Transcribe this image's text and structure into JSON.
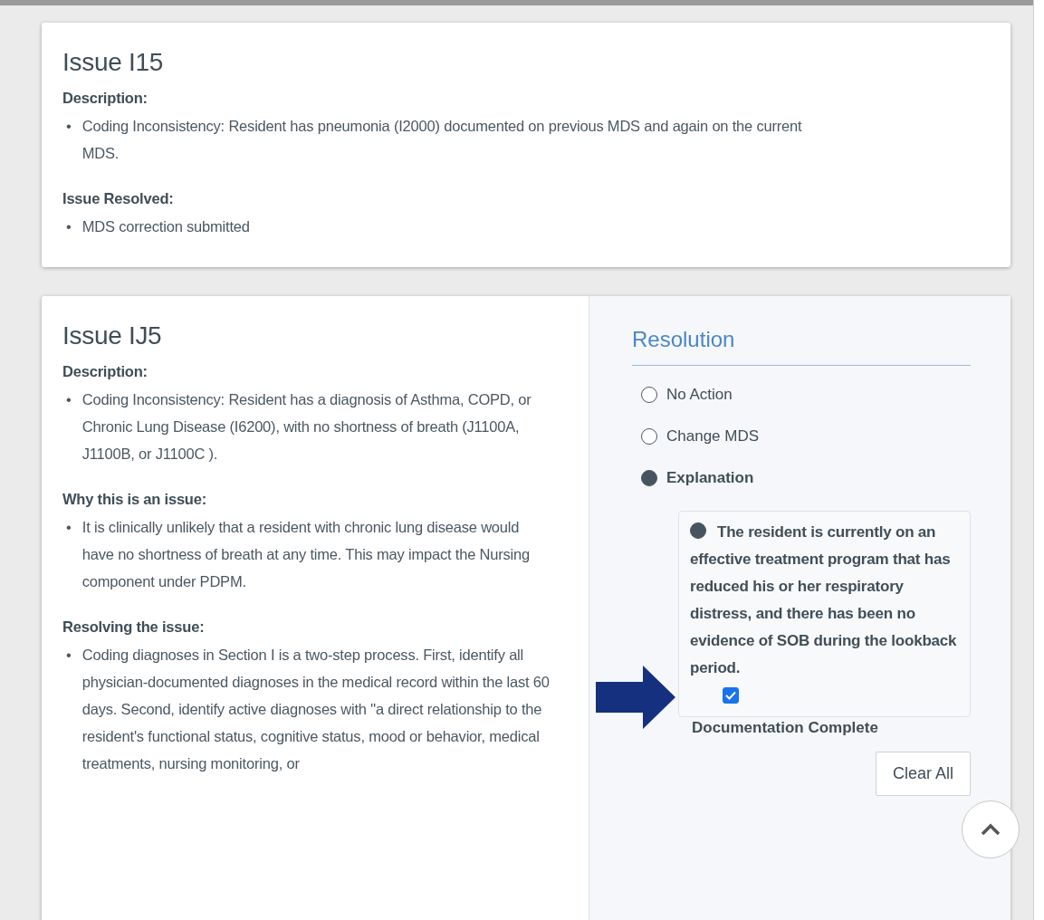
{
  "issues": [
    {
      "title": "Issue I15",
      "sections": [
        {
          "heading": "Description:",
          "items": [
            {
              "bullet": "•",
              "text": "Coding Inconsistency: Resident has pneumonia (I2000) documented on previous MDS and again on the current MDS."
            }
          ]
        },
        {
          "heading": "Issue Resolved:",
          "items": [
            {
              "bullet": "•",
              "text": "MDS correction submitted"
            }
          ]
        }
      ]
    },
    {
      "title": "Issue IJ5",
      "sections": [
        {
          "heading": "Description:",
          "items": [
            {
              "bullet": "•",
              "text": "Coding Inconsistency: Resident has a diagnosis of Asthma, COPD, or Chronic Lung Disease (I6200), with no shortness of breath (J1100A, J1100B, or J1100C )."
            }
          ]
        },
        {
          "heading": "Why this is an issue:",
          "items": [
            {
              "bullet": "•",
              "text": "It is clinically unlikely that a resident with chronic lung disease would have no shortness of breath at any time. This may impact the Nursing component under PDPM."
            }
          ]
        },
        {
          "heading": "Resolving the issue:",
          "items": [
            {
              "bullet": "•",
              "text": "Coding diagnoses in Section I is a two-step process. First, identify all physician-documented diagnoses in the medical record within the last 60 days. Second, identify active diagnoses with \"a direct relationship to the resident's functional status, cognitive status, mood or behavior, medical treatments, nursing monitoring, or"
            }
          ]
        }
      ],
      "resolution": {
        "title": "Resolution",
        "options": [
          {
            "label": "No Action",
            "selected": false
          },
          {
            "label": "Change MDS",
            "selected": false
          },
          {
            "label": "Explanation",
            "selected": true
          }
        ],
        "explanation": {
          "text": "The resident is currently on an effective treatment program that has reduced his or her respiratory distress, and there has been no evidence of SOB during the lookback period.",
          "selected": true,
          "checkbox": {
            "label": "Documentation Complete",
            "checked": true
          }
        },
        "clear_button": "Clear All"
      }
    }
  ]
}
